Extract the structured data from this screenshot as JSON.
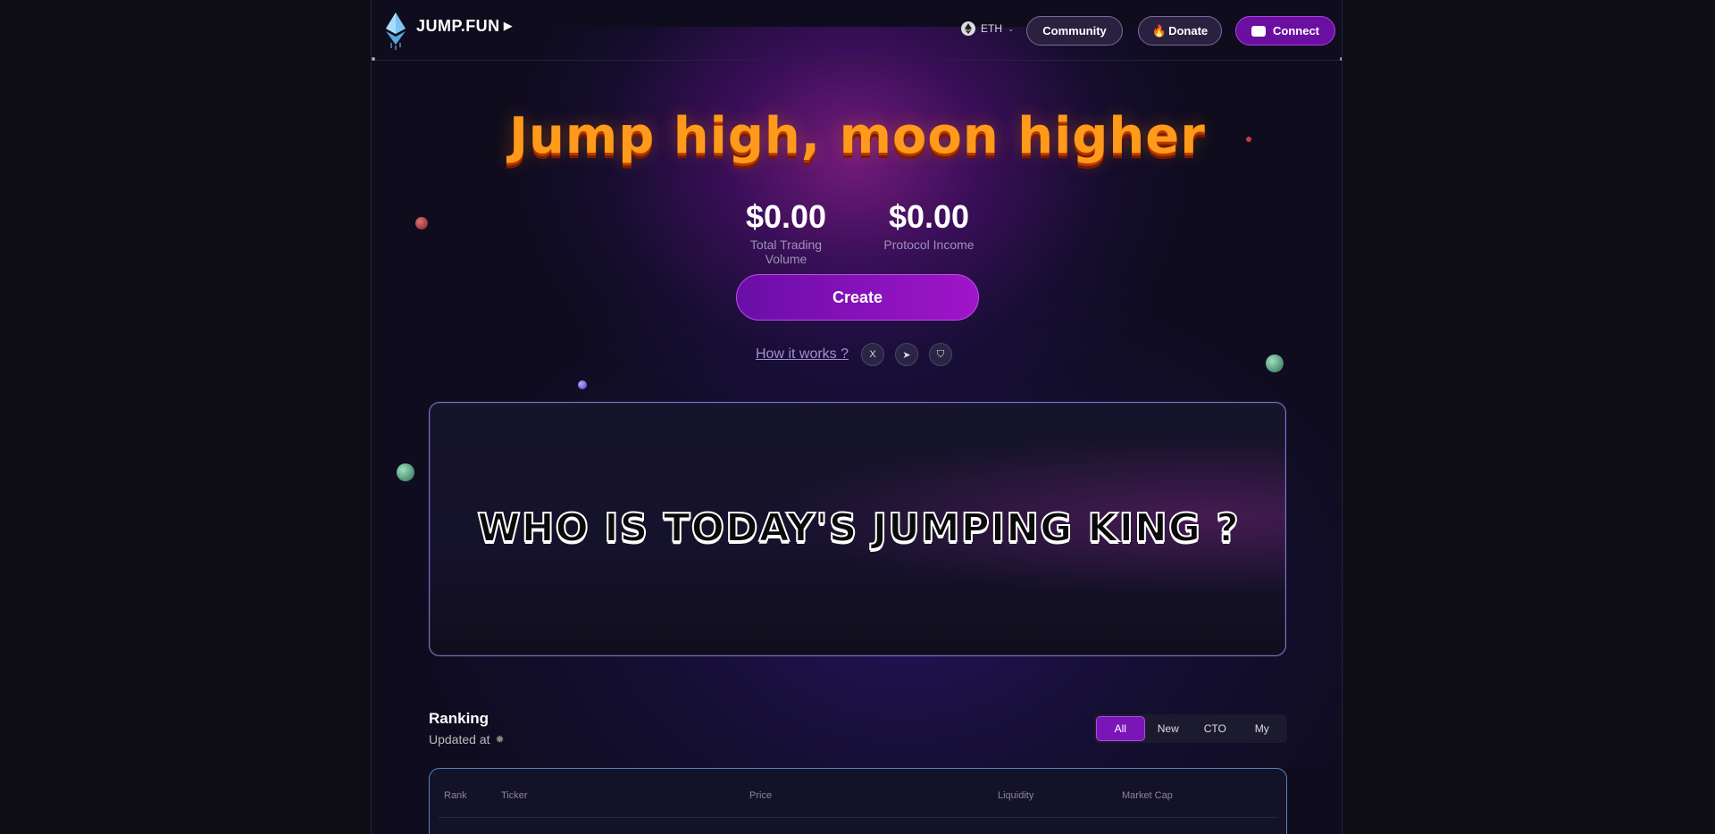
{
  "header": {
    "logo_text": "JUMP.FUN",
    "chain": "ETH",
    "community_label": "Community",
    "donate_label": "Donate",
    "connect_label": "Connect"
  },
  "hero": {
    "title": "Jump high, moon higher",
    "stats": [
      {
        "value": "$0.00",
        "label": "Total Trading Volume"
      },
      {
        "value": "$0.00",
        "label": "Protocol Income"
      }
    ],
    "create_label": "Create",
    "how_it_works": "How it works ?",
    "social": [
      {
        "icon": "x-icon",
        "glyph": "X"
      },
      {
        "icon": "telegram-icon",
        "glyph": "➤"
      },
      {
        "icon": "shield-icon",
        "glyph": "⛉"
      }
    ]
  },
  "banner": {
    "title": "WHO IS TODAY'S JUMPING KING ?"
  },
  "ranking": {
    "title": "Ranking",
    "updated_label": "Updated at",
    "tabs": [
      "All",
      "New",
      "CTO",
      "My"
    ],
    "active_tab": "All",
    "columns": [
      "Rank",
      "Ticker",
      "Price",
      "Liquidity",
      "Market Cap"
    ]
  },
  "colors": {
    "accent": "#7a16b8",
    "title_orange": "#ff9a1a",
    "background": "#0e0c1d"
  }
}
